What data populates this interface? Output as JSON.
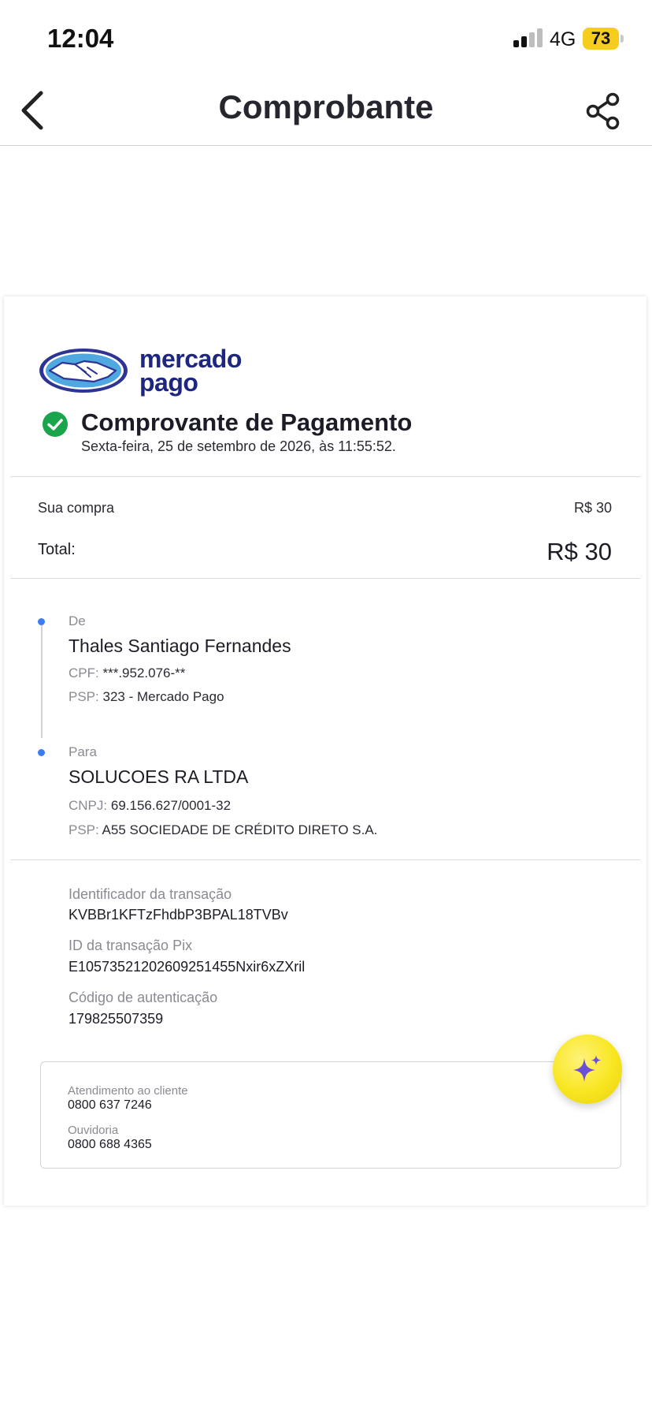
{
  "status_bar": {
    "time": "12:04",
    "network": "4G",
    "battery": "73"
  },
  "nav": {
    "title": "Comprobante",
    "back_icon": "chevron-left-icon",
    "share_icon": "share-icon"
  },
  "receipt": {
    "brand_line1": "mercado",
    "brand_line2": "pago",
    "title": "Comprovante de Pagamento",
    "date": "Sexta-feira, 25 de setembro de 2026, às 11:55:52.",
    "purchase_label": "Sua compra",
    "purchase_value": "R$ 30",
    "total_label": "Total:",
    "total_value": "R$ 30",
    "from": {
      "label": "De",
      "name": "Thales Santiago Fernandes",
      "doc_key": "CPF:",
      "doc_value": "***.952.076-**",
      "psp_key": "PSP:",
      "psp_value": "323 - Mercado Pago"
    },
    "to": {
      "label": "Para",
      "name": "SOLUCOES RA LTDA",
      "doc_key": "CNPJ:",
      "doc_value": "69.156.627/0001-32",
      "psp_key": "PSP:",
      "psp_value": "A55 SOCIEDADE DE CRÉDITO DIRETO S.A."
    },
    "transaction": {
      "id_label": "Identificador da transação",
      "id_value": "KVBBr1KFTzFhdbP3BPAL18TVBv",
      "pix_label": "ID da transação Pix",
      "pix_value": "E10573521202609251455Nxir6xZXril",
      "auth_label": "Código de autenticação",
      "auth_value": "179825507359"
    },
    "contact": {
      "support_label": "Atendimento ao cliente",
      "support_value": "0800 637 7246",
      "ombudsman_label": "Ouvidoria",
      "ombudsman_value": "0800 688 4365"
    }
  },
  "fab": {
    "icon": "sparkle-icon"
  },
  "colors": {
    "brand": "#1d2680",
    "accent_dot": "#3d7cf0",
    "success": "#1aa44b",
    "fab": "#f8e620",
    "battery": "#f6cd1c"
  }
}
